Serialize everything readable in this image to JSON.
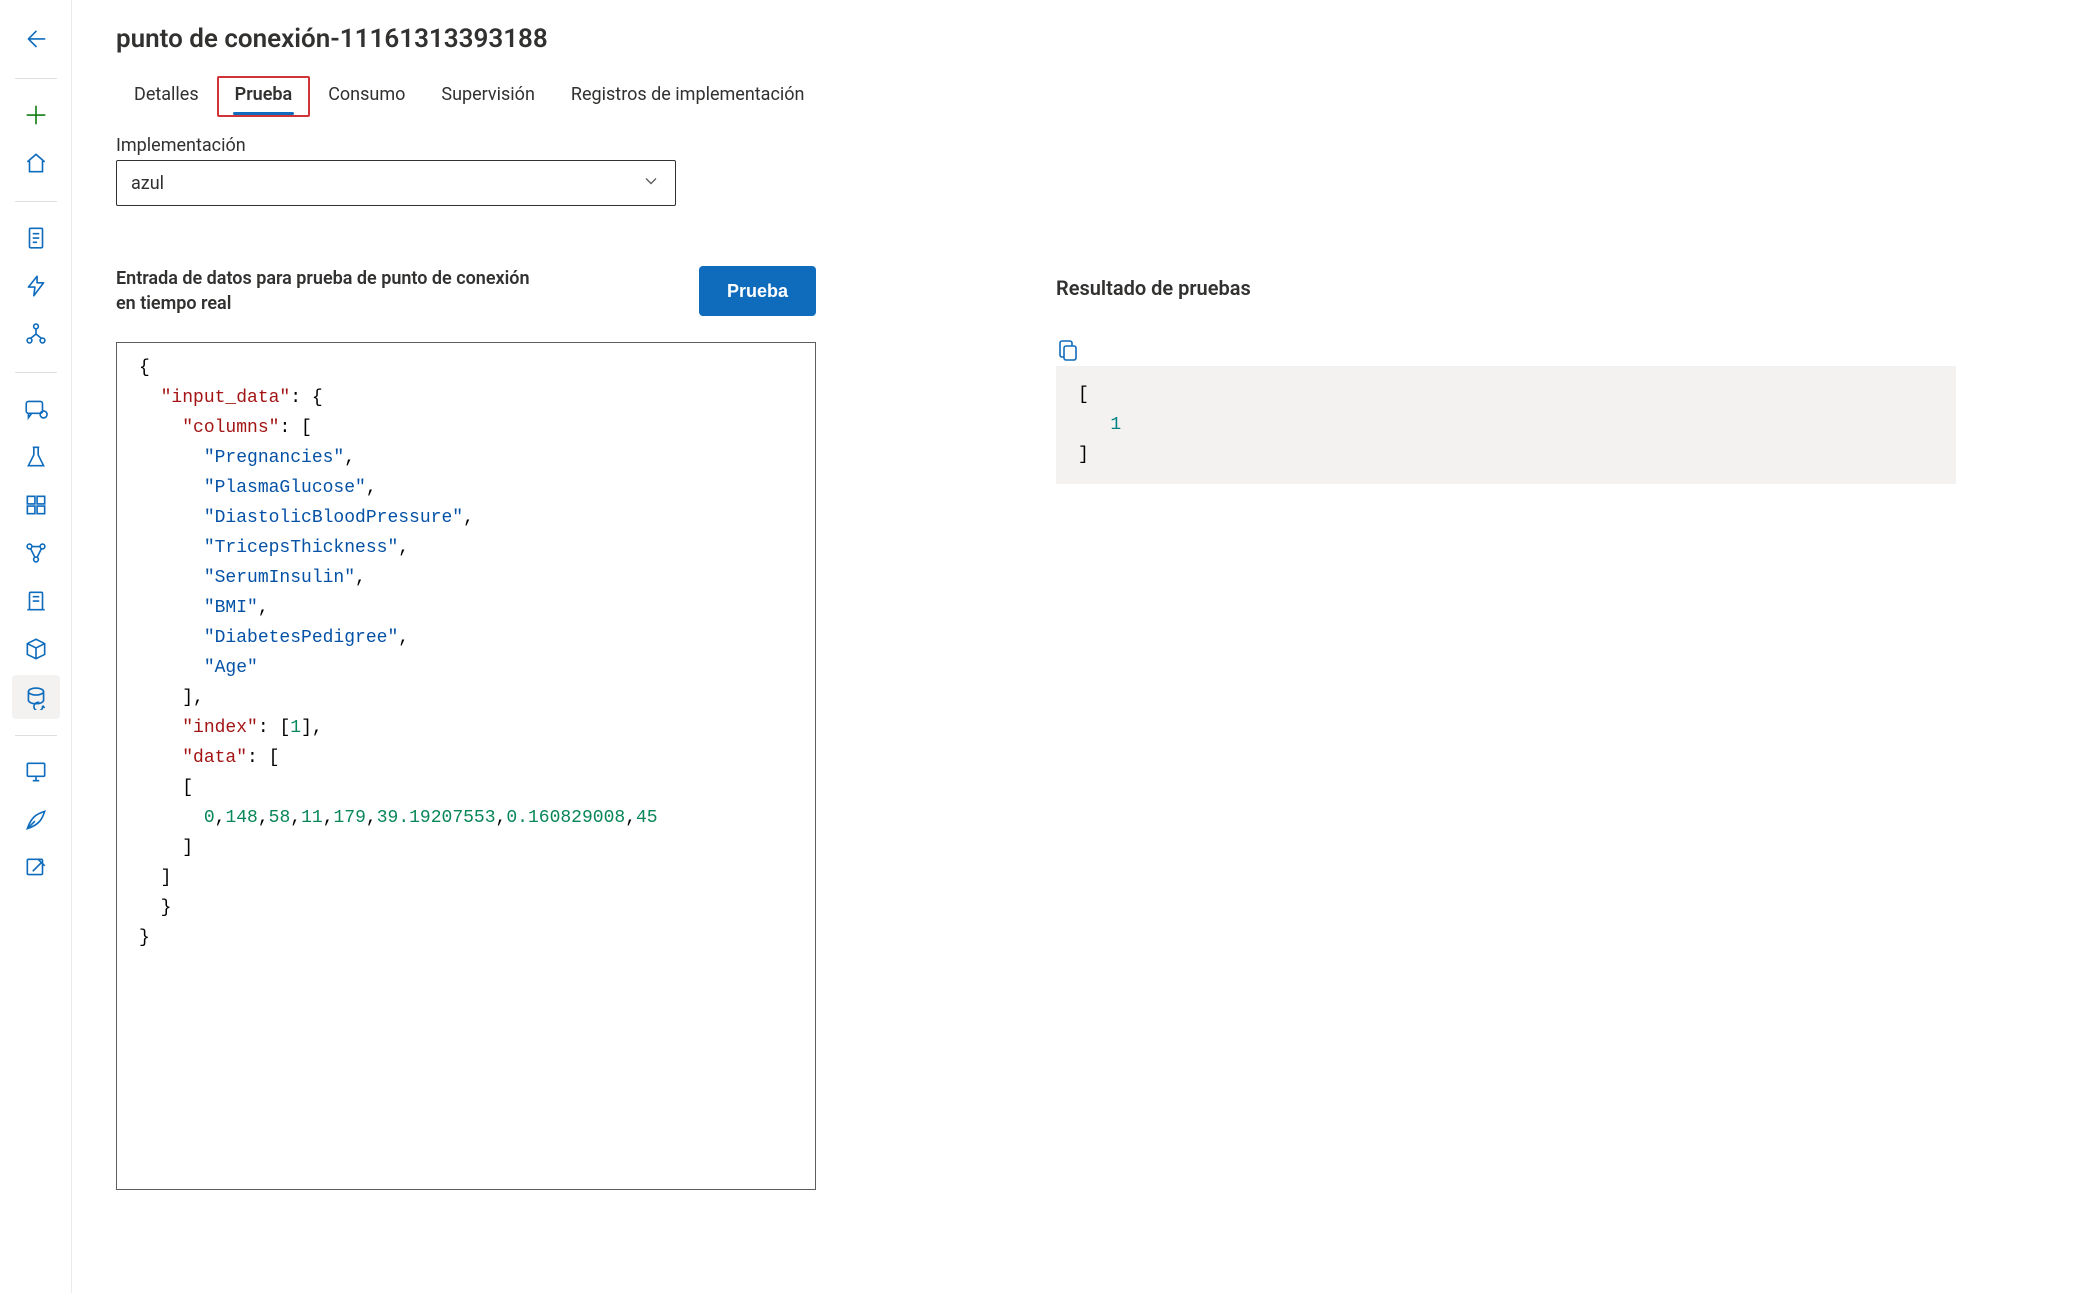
{
  "page_title": "punto de conexión-11161313393188",
  "tabs": [
    {
      "label": "Detalles",
      "active": false,
      "highlighted": false
    },
    {
      "label": "Prueba",
      "active": true,
      "highlighted": true
    },
    {
      "label": "Consumo",
      "active": false,
      "highlighted": false
    },
    {
      "label": "Supervisión",
      "active": false,
      "highlighted": false
    },
    {
      "label": "Registros de implementación",
      "active": false,
      "highlighted": false
    }
  ],
  "deployment": {
    "label": "Implementación",
    "selected": "azul"
  },
  "input_section": {
    "title": "Entrada de datos para prueba de punto de conexión en tiempo real",
    "button_label": "Prueba",
    "json": {
      "input_data": {
        "columns": [
          "Pregnancies",
          "PlasmaGlucose",
          "DiastolicBloodPressure",
          "TricepsThickness",
          "SerumInsulin",
          "BMI",
          "DiabetesPedigree",
          "Age"
        ],
        "index": [
          1
        ],
        "data": [
          [
            0,
            148,
            58,
            11,
            179,
            39.19207553,
            0.160829008,
            45
          ]
        ]
      }
    }
  },
  "result_section": {
    "title": "Resultado de pruebas",
    "output": [
      1
    ]
  },
  "rail_icons": [
    {
      "name": "back-icon",
      "kind": "back",
      "color": "blue"
    },
    {
      "sep": true
    },
    {
      "name": "add-icon",
      "kind": "plus",
      "color": "green"
    },
    {
      "name": "home-icon",
      "kind": "home",
      "color": "blue"
    },
    {
      "sep": true
    },
    {
      "name": "doc-icon",
      "kind": "doc",
      "color": "blue"
    },
    {
      "name": "bolt-icon",
      "kind": "bolt",
      "color": "blue"
    },
    {
      "name": "tree-icon",
      "kind": "tree",
      "color": "blue"
    },
    {
      "sep": true
    },
    {
      "name": "chat-icon",
      "kind": "chat",
      "color": "blue"
    },
    {
      "name": "lab-icon",
      "kind": "lab",
      "color": "blue"
    },
    {
      "name": "grid-icon",
      "kind": "grid",
      "color": "blue"
    },
    {
      "name": "pipeline-icon",
      "kind": "pipe",
      "color": "blue"
    },
    {
      "name": "server-icon",
      "kind": "server",
      "color": "blue"
    },
    {
      "name": "cube-icon",
      "kind": "cube",
      "color": "blue"
    },
    {
      "name": "endpoint-icon",
      "kind": "endpoint",
      "color": "blue",
      "selected": true
    },
    {
      "sep": true
    },
    {
      "name": "monitor-icon",
      "kind": "monitor",
      "color": "blue"
    },
    {
      "name": "pen-icon",
      "kind": "pen",
      "color": "blue"
    },
    {
      "name": "compose-icon",
      "kind": "compose",
      "color": "blue"
    }
  ]
}
